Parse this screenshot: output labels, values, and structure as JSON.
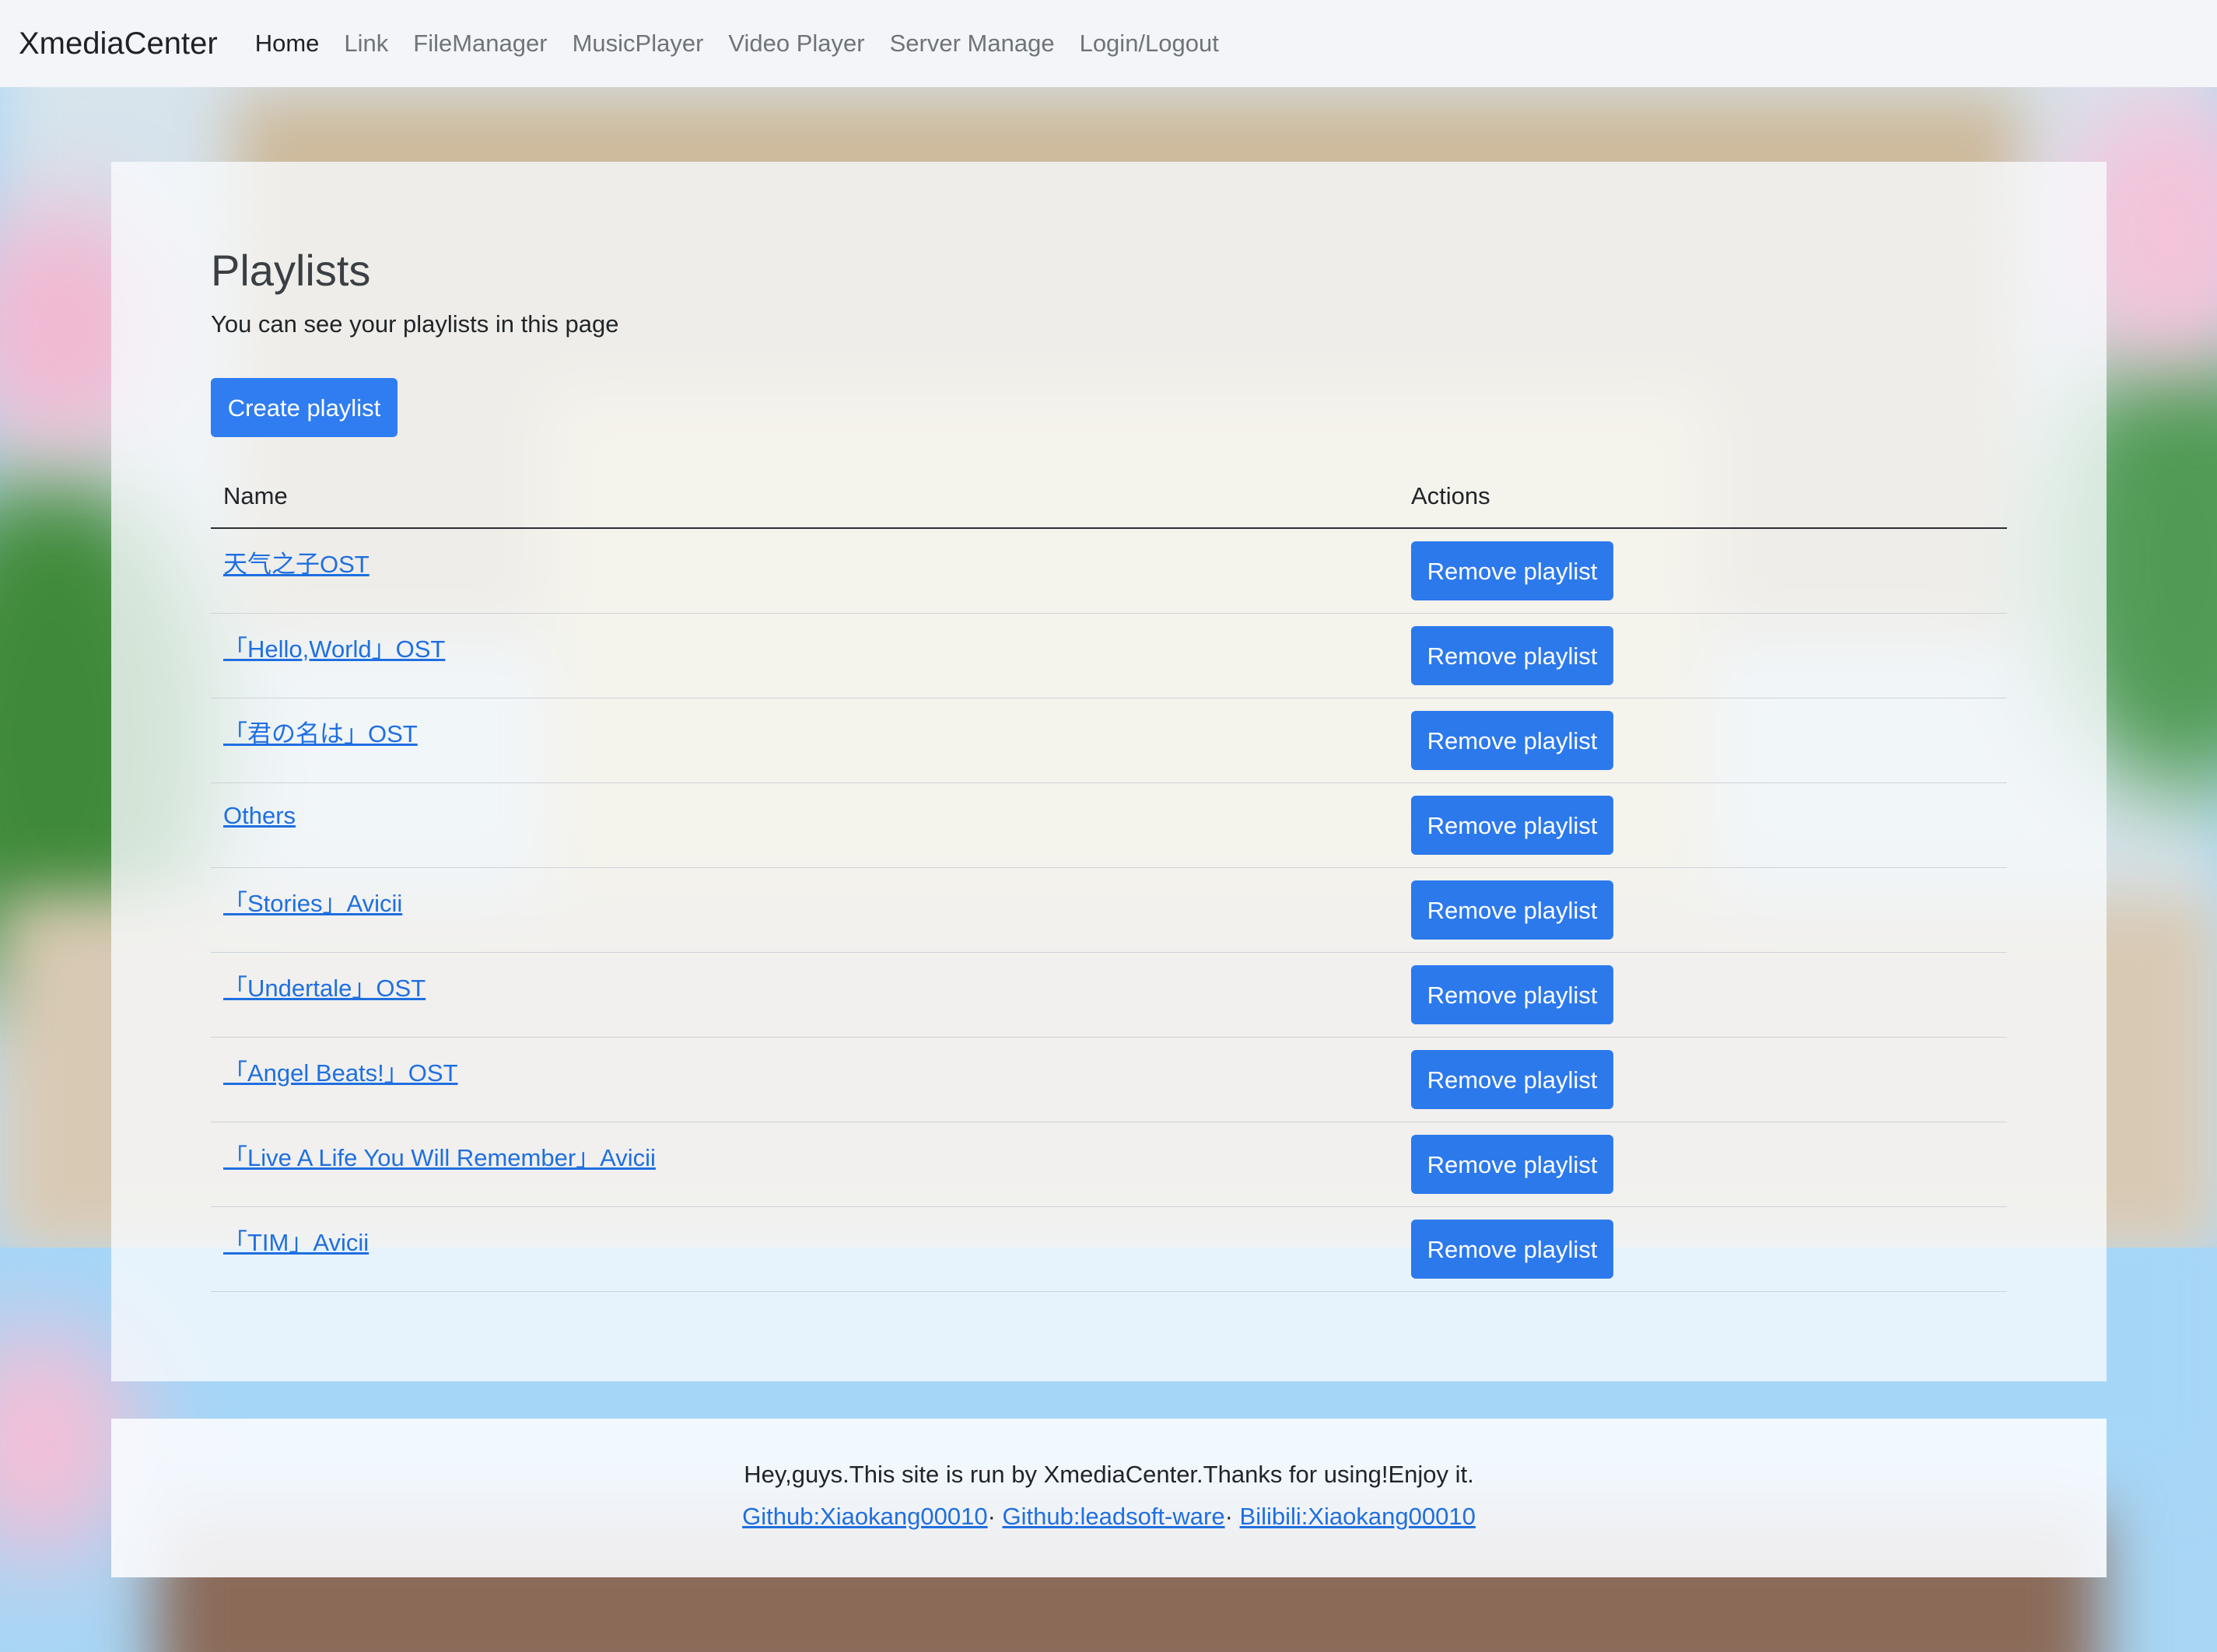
{
  "navbar": {
    "brand": "XmediaCenter",
    "items": [
      {
        "label": "Home",
        "active": true
      },
      {
        "label": "Link",
        "active": false
      },
      {
        "label": "FileManager",
        "active": false
      },
      {
        "label": "MusicPlayer",
        "active": false
      },
      {
        "label": "Video Player",
        "active": false
      },
      {
        "label": "Server Manage",
        "active": false
      },
      {
        "label": "Login/Logout",
        "active": false
      }
    ]
  },
  "main": {
    "title": "Playlists",
    "subtitle": "You can see your playlists in this page",
    "create_label": "Create playlist",
    "table": {
      "headers": [
        "Name",
        "Actions"
      ],
      "remove_label": "Remove playlist",
      "rows": [
        {
          "name": "天气之子OST"
        },
        {
          "name": "「Hello,World」OST"
        },
        {
          "name": "「君の名は」OST"
        },
        {
          "name": "Others"
        },
        {
          "name": "「Stories」Avicii"
        },
        {
          "name": "「Undertale」OST"
        },
        {
          "name": "「Angel Beats!」OST"
        },
        {
          "name": "「Live A Life You Will Remember」Avicii"
        },
        {
          "name": "「TIM」Avicii"
        }
      ]
    }
  },
  "footer": {
    "text": "Hey,guys.This site is run by XmediaCenter.Thanks for using!Enjoy it.",
    "links": [
      {
        "label": "Github:Xiaokang00010"
      },
      {
        "label": "Github:leadsoft-ware"
      },
      {
        "label": "Bilibili:Xiaokang00010"
      }
    ],
    "separator": "·"
  },
  "colors": {
    "primary_button": "#2f7df1",
    "link": "#1f6fe0",
    "navbar_bg": "#f3f5f8",
    "sky": "#a9d6f5"
  }
}
